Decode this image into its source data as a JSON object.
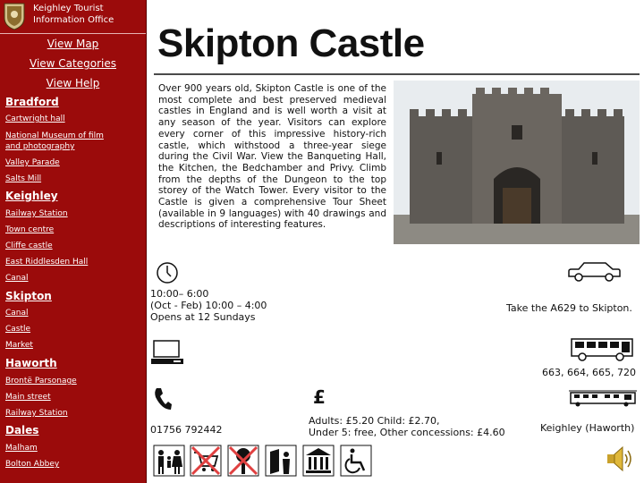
{
  "sidebar": {
    "office_name_line1": "Keighley Tourist",
    "office_name_line2": "Information Office",
    "nav": {
      "map": "View Map",
      "categories": "View Categories",
      "help": "View Help"
    },
    "sections": [
      {
        "heading": "Bradford",
        "items": [
          "Cartwright hall",
          "National Museum of film and photography",
          "Valley Parade",
          "Salts Mill"
        ]
      },
      {
        "heading": "Keighley",
        "items": [
          "Railway Station",
          "Town centre",
          "Cliffe castle",
          "East Riddlesden Hall",
          "Canal"
        ]
      },
      {
        "heading": "Skipton",
        "items": [
          "Canal",
          "Castle",
          "Market"
        ]
      },
      {
        "heading": "Haworth",
        "items": [
          "Brontë Parsonage",
          "Main street",
          "Railway Station"
        ]
      },
      {
        "heading": "Dales",
        "items": [
          "Malham",
          "Bolton Abbey"
        ]
      }
    ]
  },
  "main": {
    "title": "Skipton Castle",
    "description": "Over 900 years old, Skipton Castle is one of the most complete and best preserved medieval castles in England and is well worth a visit at any season of the year. Visitors can explore every corner of this impressive history-rich castle, which withstood a three-year siege during the Civil War. View the Banqueting Hall, the Kitchen, the Bedchamber and Privy. Climb from the depths of the Dungeon to the top storey of the Watch Tower. Every visitor to the Castle is given a comprehensive Tour Sheet (available in 9 languages) with 40 drawings and descriptions of interesting features.",
    "hours": {
      "icon": "clock-icon",
      "line1": "10:00– 6:00",
      "line2": "(Oct - Feb) 10:00 – 4:00",
      "line3": "Opens at 12 Sundays"
    },
    "car": {
      "icon": "car-icon",
      "text": "Take the A629 to Skipton."
    },
    "website": {
      "icon": "computer-icon"
    },
    "bus": {
      "icon": "bus-icon",
      "text": "663, 664, 665, 720"
    },
    "phone": {
      "icon": "telephone-icon",
      "text": "01756 792442"
    },
    "price": {
      "symbol": "£",
      "line1": "Adults: £5.20 Child: £2.70,",
      "line2": "Under 5: free, Other concessions: £4.60"
    },
    "train": {
      "icon": "train-icon",
      "text": "Keighley (Haworth)"
    },
    "facilities": [
      "family-icon",
      "no-shopping-icon",
      "no-parking-icon",
      "guided-tour-icon",
      "museum-icon",
      "wheelchair-icon"
    ],
    "audio": {
      "icon": "speaker-icon"
    }
  },
  "colors": {
    "sidebar_bg": "#9b0b0b",
    "sidebar_text": "#ffffff",
    "prohibited_red": "#e04040"
  }
}
